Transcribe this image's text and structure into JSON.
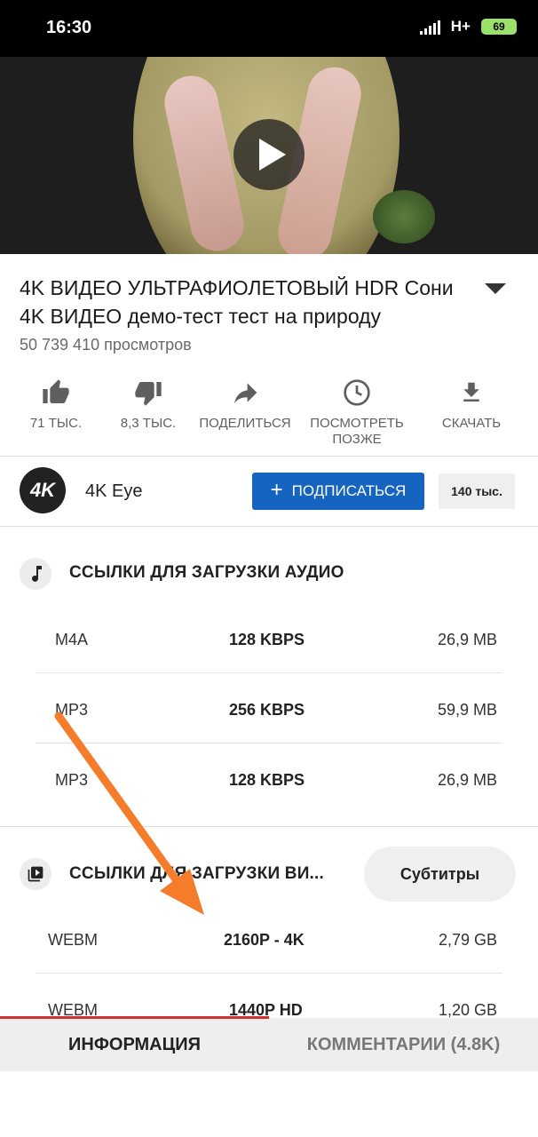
{
  "status_bar": {
    "time": "16:30",
    "network": "H+",
    "battery": "69"
  },
  "video": {
    "play_icon": "play-icon"
  },
  "title": "4K ВИДЕО УЛЬТРАФИОЛЕТОВЫЙ HDR Сони 4K ВИДЕО демо-тест тест на природу",
  "views": "50 739 410 просмотров",
  "actions": {
    "like": "71 ТЫС.",
    "dislike": "8,3 ТЫС.",
    "share": "ПОДЕЛИТЬСЯ",
    "watch_later_1": "ПОСМОТРЕТЬ",
    "watch_later_2": "ПОЗЖЕ",
    "download": "СКАЧАТЬ"
  },
  "channel": {
    "avatar_text": "4K",
    "name": "4K Eye",
    "subscribe_label": "ПОДПИСАТЬСЯ",
    "subscriber_count": "140 тыс."
  },
  "audio_section": {
    "title": "ССЫЛКИ ДЛЯ ЗАГРУЗКИ АУДИО",
    "rows": [
      {
        "format": "M4A",
        "quality": "128 KBPS",
        "size": "26,9 MB"
      },
      {
        "format": "MP3",
        "quality": "256 KBPS",
        "size": "59,9 MB"
      },
      {
        "format": "MP3",
        "quality": "128 KBPS",
        "size": "26,9 MB"
      }
    ]
  },
  "video_section": {
    "title": "ССЫЛКИ ДЛЯ ЗАГРУЗКИ ВИ...",
    "subtitles_button": "Субтитры",
    "rows": [
      {
        "format": "WEBM",
        "quality": "2160P - 4K",
        "size": "2,79 GB"
      },
      {
        "format": "WEBM",
        "quality": "1440P HD",
        "size": "1,20 GB"
      }
    ]
  },
  "tabs": {
    "info": "ИНФОРМАЦИЯ",
    "comments": "КОММЕНТАРИИ (4.8K)"
  },
  "colors": {
    "accent": "#1565c0",
    "tab_indicator": "#d32f2f",
    "annotation_arrow": "#f47c2a"
  }
}
